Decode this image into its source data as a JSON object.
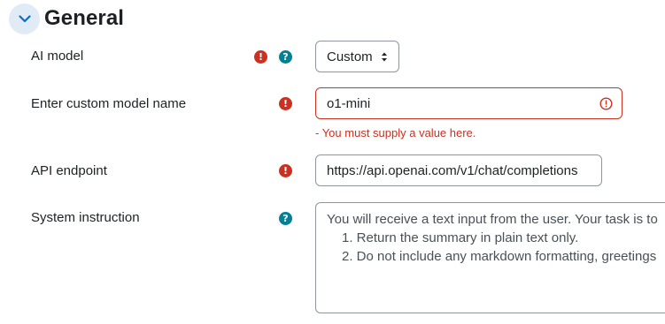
{
  "section": {
    "title": "General",
    "toggle_icon": "chevron-down-icon"
  },
  "colors": {
    "required": "#ca3120",
    "help": "#008196",
    "toggle_bg": "#e1ebf6",
    "accent": "#0f6cbf"
  },
  "fields": {
    "ai_model": {
      "label": "AI model",
      "value": "Custom"
    },
    "custom_model": {
      "label": "Enter custom model name",
      "value": "o1-mini",
      "error": "- You must supply a value here."
    },
    "api_endpoint": {
      "label": "API endpoint",
      "value": "https://api.openai.com/v1/chat/completions"
    },
    "system_instruction": {
      "label": "System instruction",
      "lines": [
        "You will receive a text input from the user. Your task is to",
        "1. Return the summary in plain text only.",
        "2. Do not include any markdown formatting, greetings"
      ]
    }
  }
}
